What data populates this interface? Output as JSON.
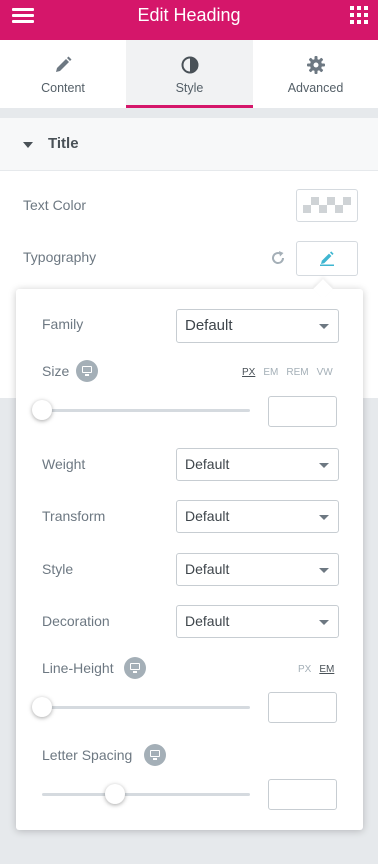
{
  "header": {
    "title": "Edit Heading",
    "menu_icon": "hamburger-icon",
    "apps_icon": "grid-icon",
    "color": "#d5166a"
  },
  "tabs": [
    {
      "label": "Content",
      "icon": "pencil-icon",
      "active": false
    },
    {
      "label": "Style",
      "icon": "contrast-icon",
      "active": true
    },
    {
      "label": "Advanced",
      "icon": "gear-icon",
      "active": false
    }
  ],
  "section": {
    "title": "Title",
    "icon": "caret-down-icon"
  },
  "controls": {
    "text_color": {
      "label": "Text Color"
    },
    "typography": {
      "label": "Typography",
      "reset_icon": "reset-icon",
      "edit_icon": "pencil-icon"
    }
  },
  "typography_popover": {
    "family": {
      "label": "Family",
      "value": "Default"
    },
    "size": {
      "label": "Size",
      "units": [
        "PX",
        "EM",
        "REM",
        "VW"
      ],
      "active_unit": "PX",
      "value": "",
      "slider_fraction": 0
    },
    "weight": {
      "label": "Weight",
      "value": "Default"
    },
    "transform": {
      "label": "Transform",
      "value": "Default"
    },
    "style": {
      "label": "Style",
      "value": "Default"
    },
    "decoration": {
      "label": "Decoration",
      "value": "Default"
    },
    "line_height": {
      "label": "Line-Height",
      "units": [
        "PX",
        "EM"
      ],
      "active_unit": "EM",
      "value": "",
      "slider_fraction": 0
    },
    "letter_spacing": {
      "label": "Letter Spacing",
      "value": "",
      "slider_fraction": 0.35
    }
  }
}
